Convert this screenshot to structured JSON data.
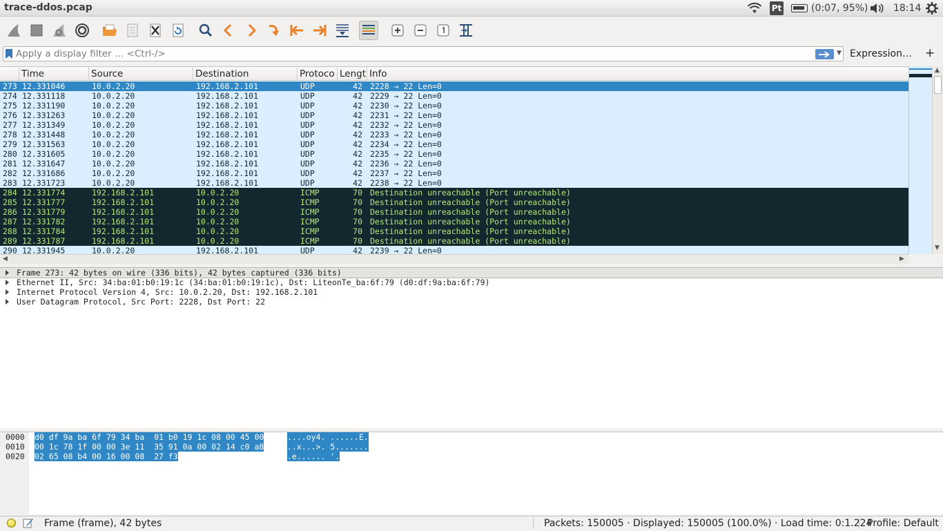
{
  "window": {
    "title": "trace-ddos.pcap"
  },
  "tray": {
    "battery": "(0:07, 95%)",
    "clock": "18:14",
    "keyboard": "Pt"
  },
  "filter": {
    "placeholder": "Apply a display filter … <Ctrl-/>",
    "value": "",
    "expression_label": "Expression…",
    "add_label": "+"
  },
  "columns": [
    "",
    "Time",
    "Source",
    "Destination",
    "Protoco",
    "Lengt",
    "Info"
  ],
  "packets": [
    {
      "no": "273",
      "time": "12.331046",
      "src": "10.0.2.20",
      "dst": "192.168.2.101",
      "proto": "UDP",
      "len": "42",
      "info": "2228 → 22 Len=0",
      "kind": "sel"
    },
    {
      "no": "274",
      "time": "12.331118",
      "src": "10.0.2.20",
      "dst": "192.168.2.101",
      "proto": "UDP",
      "len": "42",
      "info": "2229 → 22 Len=0",
      "kind": "udp"
    },
    {
      "no": "275",
      "time": "12.331190",
      "src": "10.0.2.20",
      "dst": "192.168.2.101",
      "proto": "UDP",
      "len": "42",
      "info": "2230 → 22 Len=0",
      "kind": "udp"
    },
    {
      "no": "276",
      "time": "12.331263",
      "src": "10.0.2.20",
      "dst": "192.168.2.101",
      "proto": "UDP",
      "len": "42",
      "info": "2231 → 22 Len=0",
      "kind": "udp"
    },
    {
      "no": "277",
      "time": "12.331349",
      "src": "10.0.2.20",
      "dst": "192.168.2.101",
      "proto": "UDP",
      "len": "42",
      "info": "2232 → 22 Len=0",
      "kind": "udp"
    },
    {
      "no": "278",
      "time": "12.331448",
      "src": "10.0.2.20",
      "dst": "192.168.2.101",
      "proto": "UDP",
      "len": "42",
      "info": "2233 → 22 Len=0",
      "kind": "udp"
    },
    {
      "no": "279",
      "time": "12.331563",
      "src": "10.0.2.20",
      "dst": "192.168.2.101",
      "proto": "UDP",
      "len": "42",
      "info": "2234 → 22 Len=0",
      "kind": "udp"
    },
    {
      "no": "280",
      "time": "12.331605",
      "src": "10.0.2.20",
      "dst": "192.168.2.101",
      "proto": "UDP",
      "len": "42",
      "info": "2235 → 22 Len=0",
      "kind": "udp"
    },
    {
      "no": "281",
      "time": "12.331647",
      "src": "10.0.2.20",
      "dst": "192.168.2.101",
      "proto": "UDP",
      "len": "42",
      "info": "2236 → 22 Len=0",
      "kind": "udp"
    },
    {
      "no": "282",
      "time": "12.331686",
      "src": "10.0.2.20",
      "dst": "192.168.2.101",
      "proto": "UDP",
      "len": "42",
      "info": "2237 → 22 Len=0",
      "kind": "udp"
    },
    {
      "no": "283",
      "time": "12.331723",
      "src": "10.0.2.20",
      "dst": "192.168.2.101",
      "proto": "UDP",
      "len": "42",
      "info": "2238 → 22 Len=0",
      "kind": "udp"
    },
    {
      "no": "284",
      "time": "12.331774",
      "src": "192.168.2.101",
      "dst": "10.0.2.20",
      "proto": "ICMP",
      "len": "70",
      "info": "Destination unreachable (Port unreachable)",
      "kind": "icmp"
    },
    {
      "no": "285",
      "time": "12.331777",
      "src": "192.168.2.101",
      "dst": "10.0.2.20",
      "proto": "ICMP",
      "len": "70",
      "info": "Destination unreachable (Port unreachable)",
      "kind": "icmp"
    },
    {
      "no": "286",
      "time": "12.331779",
      "src": "192.168.2.101",
      "dst": "10.0.2.20",
      "proto": "ICMP",
      "len": "70",
      "info": "Destination unreachable (Port unreachable)",
      "kind": "icmp"
    },
    {
      "no": "287",
      "time": "12.331782",
      "src": "192.168.2.101",
      "dst": "10.0.2.20",
      "proto": "ICMP",
      "len": "70",
      "info": "Destination unreachable (Port unreachable)",
      "kind": "icmp"
    },
    {
      "no": "288",
      "time": "12.331784",
      "src": "192.168.2.101",
      "dst": "10.0.2.20",
      "proto": "ICMP",
      "len": "70",
      "info": "Destination unreachable (Port unreachable)",
      "kind": "icmp"
    },
    {
      "no": "289",
      "time": "12.331787",
      "src": "192.168.2.101",
      "dst": "10.0.2.20",
      "proto": "ICMP",
      "len": "70",
      "info": "Destination unreachable (Port unreachable)",
      "kind": "icmp"
    },
    {
      "no": "290",
      "time": "12.331945",
      "src": "10.0.2.20",
      "dst": "192.168.2.101",
      "proto": "UDP",
      "len": "42",
      "info": "2239 → 22 Len=0",
      "kind": "udp"
    }
  ],
  "details": [
    "Frame 273: 42 bytes on wire (336 bits), 42 bytes captured (336 bits)",
    "Ethernet II, Src: 34:ba:01:b0:19:1c (34:ba:01:b0:19:1c), Dst: LiteonTe_ba:6f:79 (d0:df:9a:ba:6f:79)",
    "Internet Protocol Version 4, Src: 10.0.2.20, Dst: 192.168.2.101",
    "User Datagram Protocol, Src Port: 2228, Dst Port: 22"
  ],
  "bytes": [
    {
      "offset": "0000",
      "hex": "d0 df 9a ba 6f 79 34 ba  01 b0 19 1c 08 00 45 00",
      "ascii": "....oy4. ......E."
    },
    {
      "offset": "0010",
      "hex": "00 1c 78 1f 00 00 3e 11  35 91 0a 00 02 14 c0 a8",
      "ascii": "..x...>. 5......."
    },
    {
      "offset": "0020",
      "hex": "02 65 08 b4 00 16 00 08  27 f3",
      "ascii": ".e...... '."
    }
  ],
  "status": {
    "frame": "Frame (frame), 42 bytes",
    "packets": "Packets: 150005 · Displayed: 150005 (100.0%) · Load time: 0:1.224",
    "profile": "Profile: Default"
  },
  "colors": {
    "selected": "#3087c6",
    "udp_bg": "#daeeff",
    "icmp_bg": "#12272e",
    "icmp_fg": "#b6e878"
  }
}
